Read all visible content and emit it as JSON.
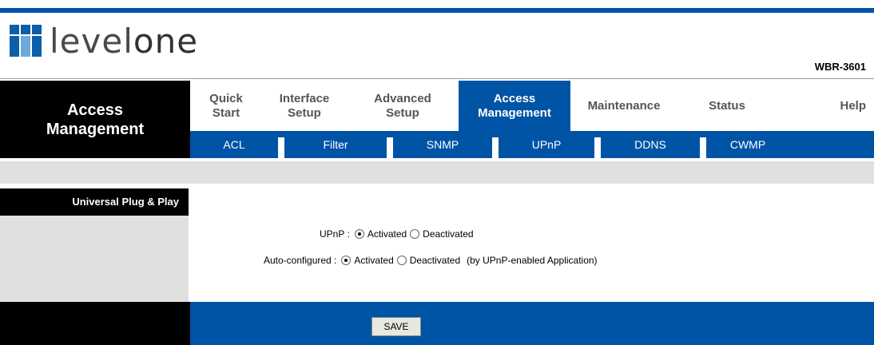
{
  "header": {
    "brand_prefix": "level",
    "brand_suffix": "one",
    "model": "WBR-3601"
  },
  "sidebar": {
    "title_line1": "Access",
    "title_line2": "Management",
    "section_label": "Universal Plug & Play"
  },
  "main_nav": [
    {
      "line1": "Quick",
      "line2": "Start",
      "active": false
    },
    {
      "line1": "Interface",
      "line2": "Setup",
      "active": false
    },
    {
      "line1": "Advanced",
      "line2": "Setup",
      "active": false
    },
    {
      "line1": "Access",
      "line2": "Management",
      "active": true
    },
    {
      "line1": "Maintenance",
      "line2": "",
      "active": false
    },
    {
      "line1": "Status",
      "line2": "",
      "active": false
    },
    {
      "line1": "Help",
      "line2": "",
      "active": false
    }
  ],
  "sub_nav": [
    "ACL",
    "Filter",
    "SNMP",
    "UPnP",
    "DDNS",
    "CWMP"
  ],
  "form": {
    "upnp": {
      "label": "UPnP :",
      "options": [
        "Activated",
        "Deactivated"
      ],
      "selected": "Activated"
    },
    "auto": {
      "label": "Auto-configured :",
      "options": [
        "Activated",
        "Deactivated"
      ],
      "selected": "Activated",
      "note": "(by UPnP-enabled Application)"
    }
  },
  "footer": {
    "save_label": "SAVE"
  },
  "colors": {
    "brand_blue": "#0054a6",
    "panel_grey": "#e0e0e0",
    "black": "#000000"
  }
}
